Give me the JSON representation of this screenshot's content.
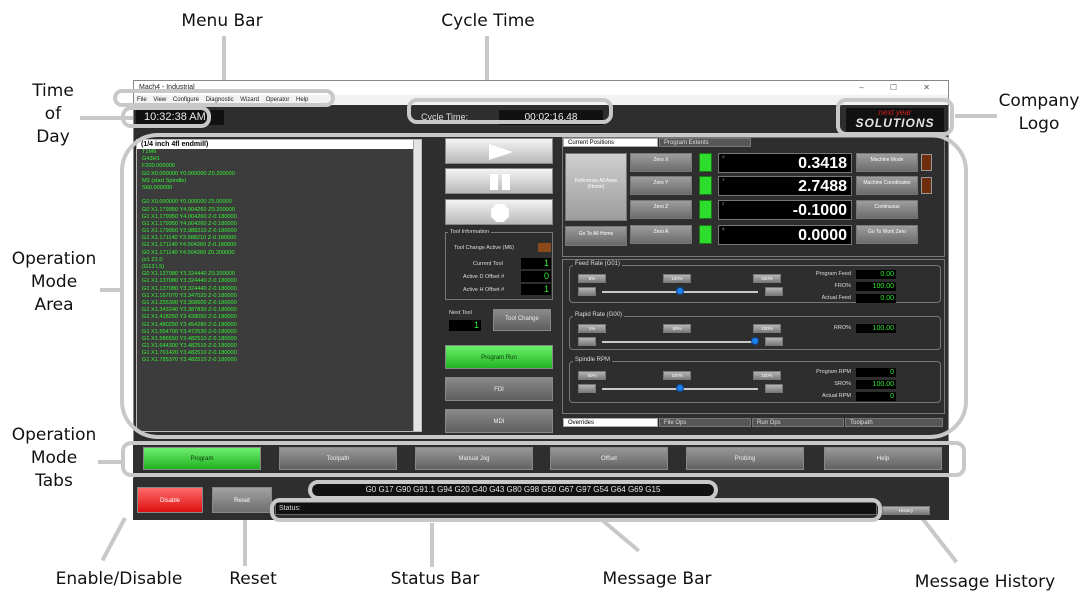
{
  "callouts": {
    "menu_bar": "Menu Bar",
    "cycle_time": "Cycle Time",
    "time_of_day": [
      "Time",
      "of",
      "Day"
    ],
    "company_logo": [
      "Company",
      "Logo"
    ],
    "operation_mode_area": [
      "Operation",
      "Mode",
      "Area"
    ],
    "operation_mode_tabs": [
      "Operation",
      "Mode",
      "Tabs"
    ],
    "enable_disable": "Enable/Disable",
    "reset": "Reset",
    "status_bar": "Status Bar",
    "message_bar": "Message Bar",
    "message_history": "Message History"
  },
  "window": {
    "title": "Mach4 - Industrial",
    "controls": "–  ☐  ✕",
    "menu": [
      "File",
      "View",
      "Configure",
      "Diagnostic",
      "Wizard",
      "Operator",
      "Help"
    ]
  },
  "header": {
    "time_of_day": "10:32:38 AM",
    "cycle_label": "Cycle Time:",
    "cycle_value": "00:02:16.48",
    "logo_top": "next year",
    "logo_bottom": "SOLUTIONS"
  },
  "gcode": {
    "header": "(1/4 inch 4fl endmill)",
    "lines": [
      "T1M6",
      "G43H1",
      "F200.000000",
      "G0 X0.000000 Y0.000000 Z0.200000",
      "M3 (start Spindle)",
      "S60.000000",
      "",
      "G0 X0.000000 Y0.000000 Z5.00000",
      "G0 X1.179950 Y4.004260 Z0.200000",
      "G1 X1.179950 Y4.004260 Z-0.180000",
      "G1 X1.179950 Y4.004260 Z-0.180000",
      "G1 X1.179950 Y3.988210 Z-0.180000",
      "G1 X1.171140 Y3.988210 Z-0.180000",
      "G1 X1.171140 Y4.004260 Z-0.180000",
      "G0 X1.171140 Y4.004260 Z0.200000",
      "(s1 Z1.0",
      "(G13 L5)",
      "G0 X1.137080 Y3.324440 Z0.200000",
      "G1 X1.137080 Y3.324440 Z-0.180000",
      "G1 X1.137080 Y3.324440 Z-0.180000",
      "G1 X1.167070 Y3.347020 Z-0.180000",
      "G1 X1.255390 Y3.368600 Z-0.180000",
      "G1 X1.343240 Y3.387830 Z-0.180000",
      "G1 X1.418250 Y3.428050 Z-0.180000",
      "G1 X1.480250 Y3.454280 Z-0.180000",
      "G1 X1.554700 Y3.472530 Z-0.180000",
      "G1 X1.586550 Y3.482510 Z-0.180000",
      "G1 X1.644300 Y3.482510 Z-0.180000",
      "G1 X1.701420 Y3.482510 Z-0.180000",
      "G1 X1.785370 Y3.482510 Z-0.180000"
    ]
  },
  "tool": {
    "section": "Tool Information",
    "change_label": "Tool Change Active (M6)",
    "current_label": "Current Tool",
    "current_value": "1",
    "d_label": "Active D Offset #",
    "d_value": "0",
    "h_label": "Active H Offset #",
    "h_value": "1",
    "next_label": "Next Tool",
    "next_value": "1",
    "change_button": "Tool Change"
  },
  "modes": {
    "program_run": "Program Run",
    "fdi": "FDI",
    "mdi": "MDI"
  },
  "positions": {
    "tab_current": "Current Positions",
    "tab_extents": "Program Extents",
    "ref_all": "Reference All Axes (Home)",
    "goto_zero": "Go To All Home",
    "axes": [
      {
        "axis": "X",
        "zero": "Zero X",
        "value": "0.3418",
        "right": "Machine Mode"
      },
      {
        "axis": "Y",
        "zero": "Zero Y",
        "value": "2.7488",
        "right": "Machine Coordinates"
      },
      {
        "axis": "Z",
        "zero": "Zero Z",
        "value": "-0.1000",
        "right": "Continuous"
      },
      {
        "axis": "A",
        "zero": "Zero A",
        "value": "0.0000",
        "right": "Go To Work Zero"
      }
    ]
  },
  "overrides": {
    "feed": {
      "title": "Feed Rate (G01)",
      "btn1": "5%",
      "btn2": "100%",
      "btn3": "250%",
      "l1": "Program Feed",
      "v1": "0.00",
      "l2": "FRO%",
      "v2": "100.00",
      "l3": "Actual Feed",
      "v3": "0.00"
    },
    "rapid": {
      "title": "Rapid Rate (G00)",
      "btn1": "1%",
      "btn2": "50%",
      "btn3": "100%",
      "l1": "RRO%",
      "v1": "100.00"
    },
    "spindle": {
      "title": "Spindle RPM",
      "btn1": "50%",
      "btn2": "100%",
      "btn3": "150%",
      "l1": "Program RPM",
      "v1": "0",
      "l2": "SRO%",
      "v2": "100.00",
      "l3": "Actual RPM",
      "v3": "0"
    },
    "bottom_tabs": [
      "Overrides",
      "File Ops",
      "Run Ops",
      "Toolpath"
    ]
  },
  "tabs": [
    "Program",
    "Toolpath",
    "Manual Jog",
    "Offset",
    "Probing",
    "Help"
  ],
  "bottom": {
    "gmodes": "G0 G17 G90 G91.1 G94 G20 G40 G43 G80 G98 G50 G67 G97 G54 G64 G69 G15",
    "enable": "Disable",
    "reset": "Reset",
    "status_label": "Status:",
    "history": "History"
  },
  "colors": {
    "accent_green": "#35f235",
    "enable_red": "#dd1010",
    "halo": "#c8c8c8"
  }
}
